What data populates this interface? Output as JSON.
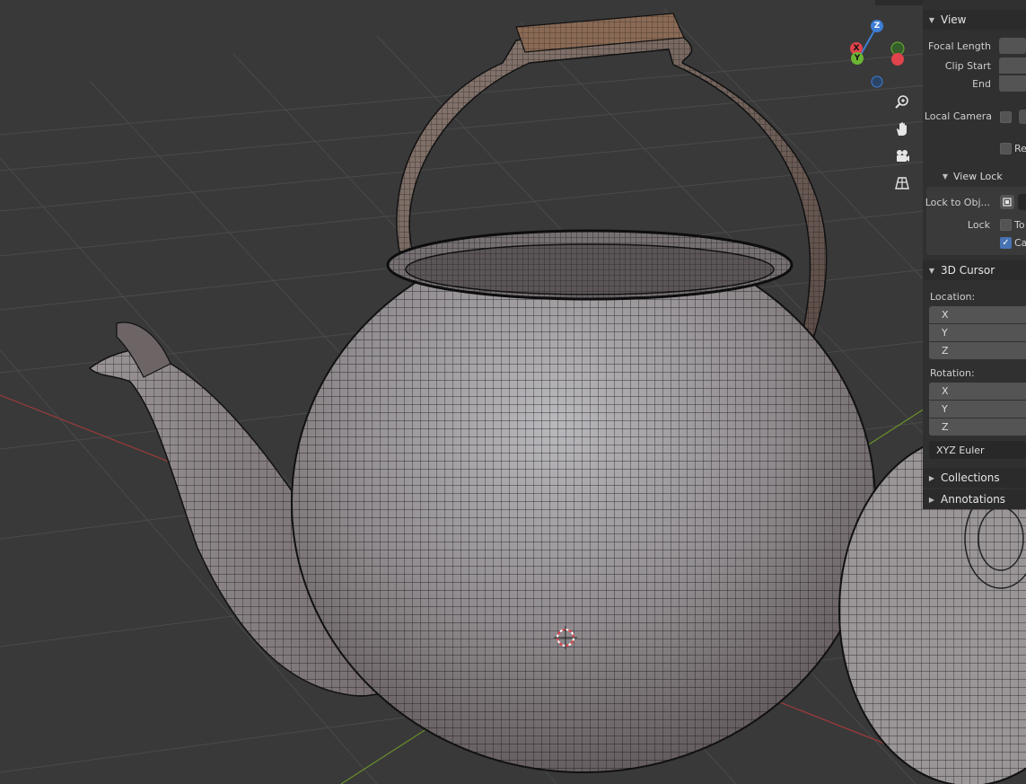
{
  "colors": {
    "background": "#393939",
    "grid": "#4a4a4a",
    "x_axis": "#9e3a3a",
    "y_axis": "#6a8f2a",
    "gizmo_x": "#e0434b",
    "gizmo_y": "#6bb533",
    "gizmo_z": "#3e7ed6",
    "sidebar_bg": "#303030",
    "field_bg": "#545454",
    "checkbox_accent": "#4772b3"
  },
  "gizmo": {
    "z_label": "Z",
    "y_label": "Y",
    "x_label": "X"
  },
  "nav_icons": [
    "zoom-icon",
    "pan-hand-icon",
    "camera-icon",
    "perspective-grid-icon"
  ],
  "sidebar": {
    "view": {
      "header": "View",
      "focal_length_label": "Focal Length",
      "clip_start_label": "Clip Start",
      "clip_end_label": "End",
      "local_camera_label": "Local Camera",
      "render_region_label": "Re",
      "view_lock": {
        "header": "View Lock",
        "lock_to_object_label": "Lock to Obj...",
        "lock_label": "Lock",
        "to_3d_cursor_label": "To",
        "camera_to_view_label": "Ca",
        "camera_to_view_checked": true
      }
    },
    "cursor": {
      "header": "3D Cursor",
      "location_label": "Location:",
      "location_axes": [
        "X",
        "Y",
        "Z"
      ],
      "rotation_label": "Rotation:",
      "rotation_axes": [
        "X",
        "Y",
        "Z"
      ],
      "rotation_mode": "XYZ Euler"
    },
    "collections_header": "Collections",
    "annotations_header": "Annotations"
  }
}
